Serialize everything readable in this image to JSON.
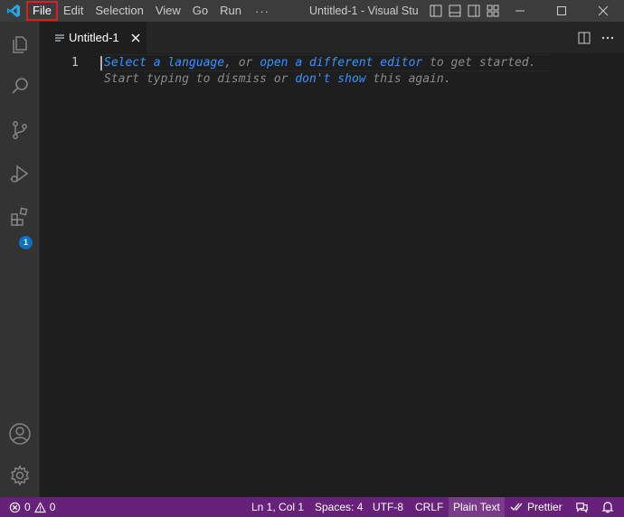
{
  "menu": {
    "items": [
      "File",
      "Edit",
      "Selection",
      "View",
      "Go",
      "Run"
    ],
    "more": "···"
  },
  "window": {
    "title": "Untitled-1 - Visual Stu"
  },
  "activity_badge": "1",
  "tab": {
    "label": "Untitled-1"
  },
  "editor": {
    "line_number": "1",
    "hint1": {
      "link1": "Select a language",
      "text1": ", or ",
      "link2": "open a different editor",
      "text2": " to get started."
    },
    "hint2": {
      "text1": "Start typing to dismiss or ",
      "link": "don't show",
      "text2": " this again."
    }
  },
  "status": {
    "errors": "0",
    "warnings": "0",
    "position": "Ln 1, Col 1",
    "spaces": "Spaces: 4",
    "encoding": "UTF-8",
    "eol": "CRLF",
    "language": "Plain Text",
    "prettier": "Prettier"
  },
  "colors": {
    "titlebar": "#3c3c3c",
    "activitybar": "#333333",
    "editor": "#1e1e1e",
    "statusbar": "#68217a",
    "link": "#3794ff",
    "highlight_box": "#e31b1b"
  }
}
